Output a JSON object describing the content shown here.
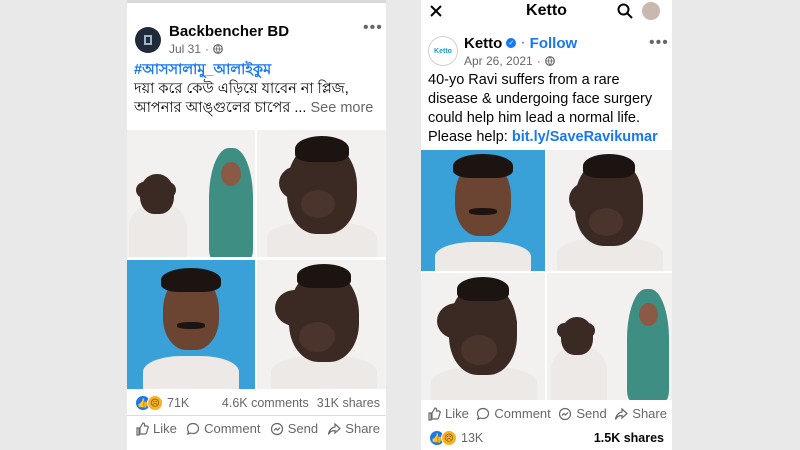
{
  "left_post": {
    "page_name": "Backbencher BD",
    "date": "Jul 31",
    "hashtag": "#আসসালামু_আলাইকুম",
    "text_line1": "দয়া করে কেউ এড়িয়ে যাবেন না প্লিজ,",
    "text_line2": "আপনার আঙ্গুলের চাপের ...",
    "see_more": "See more",
    "reactions_count": "71K",
    "comments": "4.6K comments",
    "shares": "31K shares",
    "actions": {
      "like": "Like",
      "comment": "Comment",
      "send": "Send",
      "share": "Share"
    }
  },
  "right_post": {
    "window_title": "Ketto",
    "page_name": "Ketto",
    "avatar_text": "Ketto",
    "follow": "Follow",
    "date": "Apr 26, 2021",
    "text_lines": [
      "40-yo Ravi suffers from a rare",
      "disease & undergoing face surgery",
      "could help him lead a normal life.",
      "Please help: "
    ],
    "link": "bit.ly/SaveRavikumar",
    "reactions_count": "13K",
    "shares": "1.5K shares",
    "actions": {
      "like": "Like",
      "comment": "Comment",
      "send": "Send",
      "share": "Share"
    }
  },
  "icons": {
    "close": "close-icon",
    "search": "search-icon",
    "globe": "globe-icon",
    "more": "more-options-icon"
  },
  "colors": {
    "accent": "#1877f2",
    "background": "#e9e9e9"
  }
}
